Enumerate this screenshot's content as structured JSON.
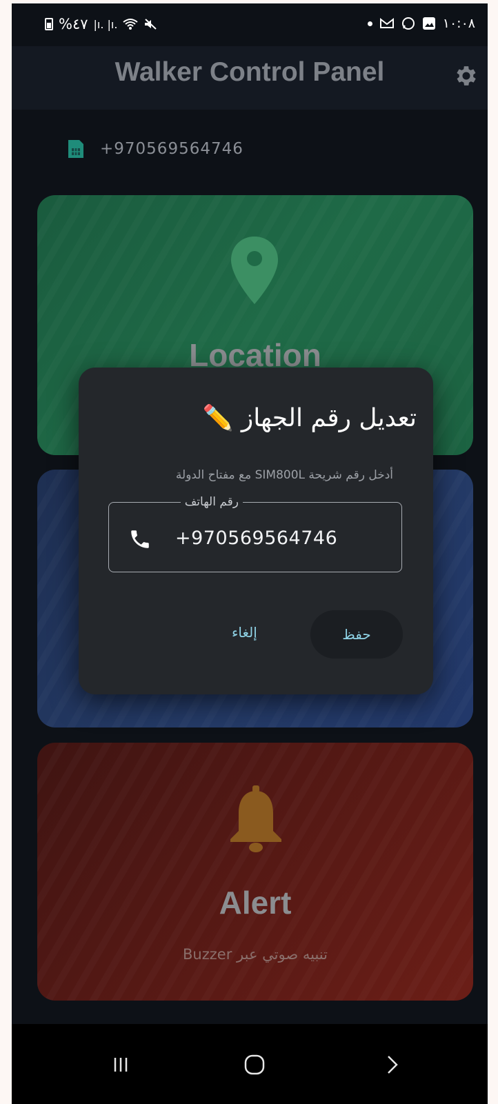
{
  "status_bar": {
    "left_text": "%٤٧",
    "signal_text": "|ı. |ı.",
    "right_time": "١٠:٠٨"
  },
  "app_bar": {
    "title": "Walker Control Panel",
    "settings_icon": "gear-icon"
  },
  "sim": {
    "icon": "sim-card-icon",
    "number": "+970569564746"
  },
  "cards": {
    "location": {
      "title": "Location",
      "icon": "location-pin-icon",
      "color": "#1f6a47"
    },
    "middle": {
      "color": "#243a66"
    },
    "alert": {
      "title": "Alert",
      "subtitle": "Buzzer تنبيه صوتي عبر",
      "icon": "bell-icon",
      "color": "#5a1a15"
    }
  },
  "dialog": {
    "title": "تعديل رقم الجهاز ✏️",
    "description": "أدخل رقم شريحة SIM800L مع مفتاح الدولة",
    "field_label": "رقم الهاتف",
    "field_value": "+970569564746",
    "save_label": "حفظ",
    "cancel_label": "إلغاء",
    "accent_color": "#8fd3e6"
  },
  "nav": {
    "recents": "recents-icon",
    "home": "home-icon",
    "back": "back-icon"
  }
}
